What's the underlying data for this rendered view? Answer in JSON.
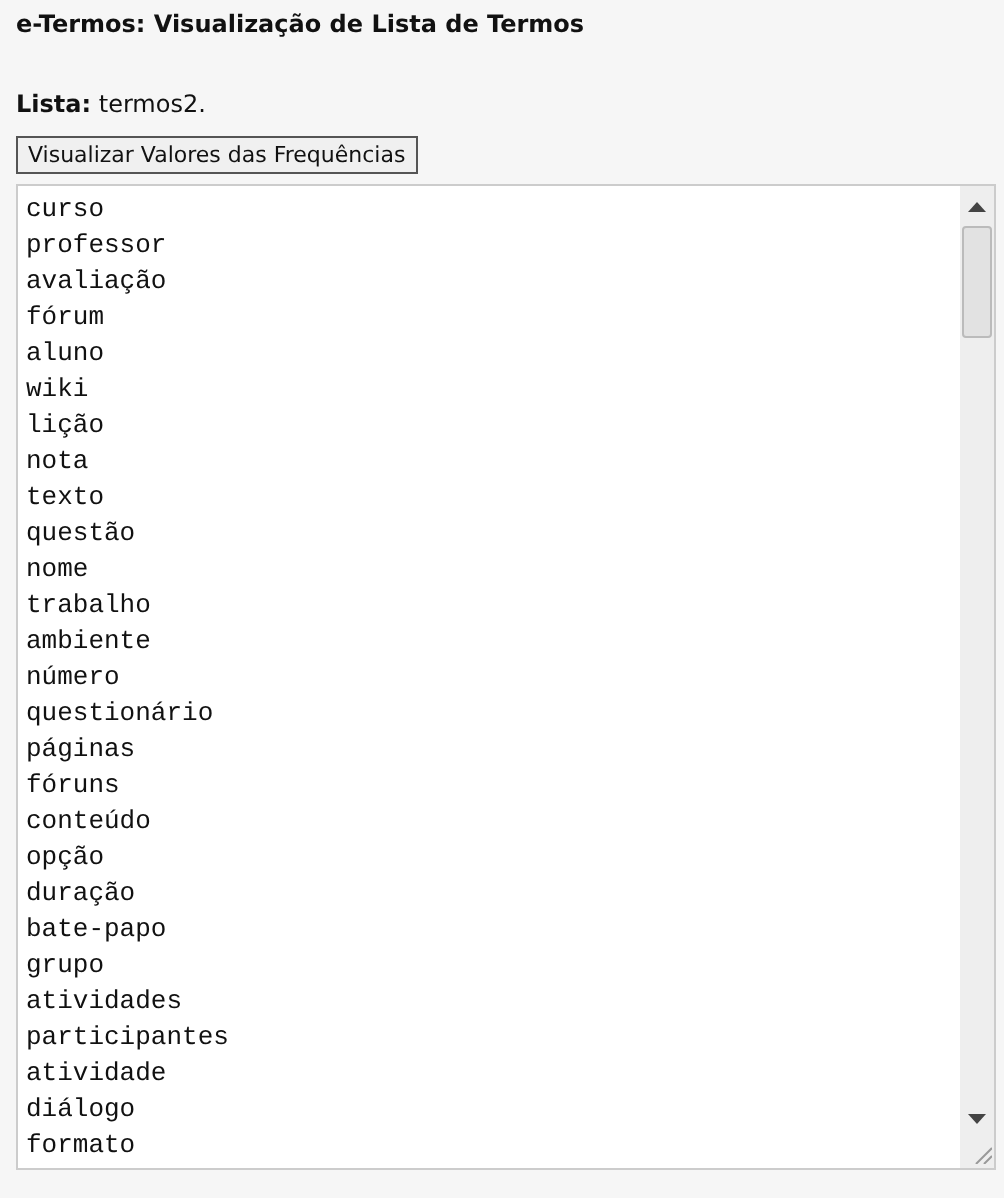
{
  "title": "e-Termos: Visualização de Lista de Termos",
  "list_label": "Lista:",
  "list_name": "termos2.",
  "button": "Visualizar Valores das Frequências",
  "terms": [
    "curso",
    "professor",
    "avaliação",
    "fórum",
    "aluno",
    "wiki",
    "lição",
    "nota",
    "texto",
    "questão",
    "nome",
    "trabalho",
    "ambiente",
    "número",
    "questionário",
    "páginas",
    "fóruns",
    "conteúdo",
    "opção",
    "duração",
    "bate-papo",
    "grupo",
    "atividades",
    "participantes",
    "atividade",
    "diálogo",
    "formato"
  ]
}
